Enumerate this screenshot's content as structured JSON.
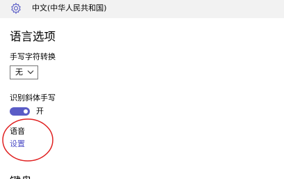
{
  "header": {
    "language_name": "中文(中华人民共和国)",
    "icon": "gear-icon"
  },
  "language_options": {
    "title": "语言选项",
    "handwriting_conversion": {
      "label": "手写字符转换",
      "selected_value": "无"
    },
    "italic_handwriting": {
      "label": "识别斜体手写",
      "state_label": "开",
      "on": true
    },
    "voice": {
      "label": "语音",
      "settings_link": "设置"
    },
    "next_section_title_partial": "键盘"
  },
  "colors": {
    "toggle_on": "#5a5cc6",
    "link": "#4f4fc7",
    "annotation_circle": "#e02020",
    "header_bg": "#f2f2f2"
  }
}
